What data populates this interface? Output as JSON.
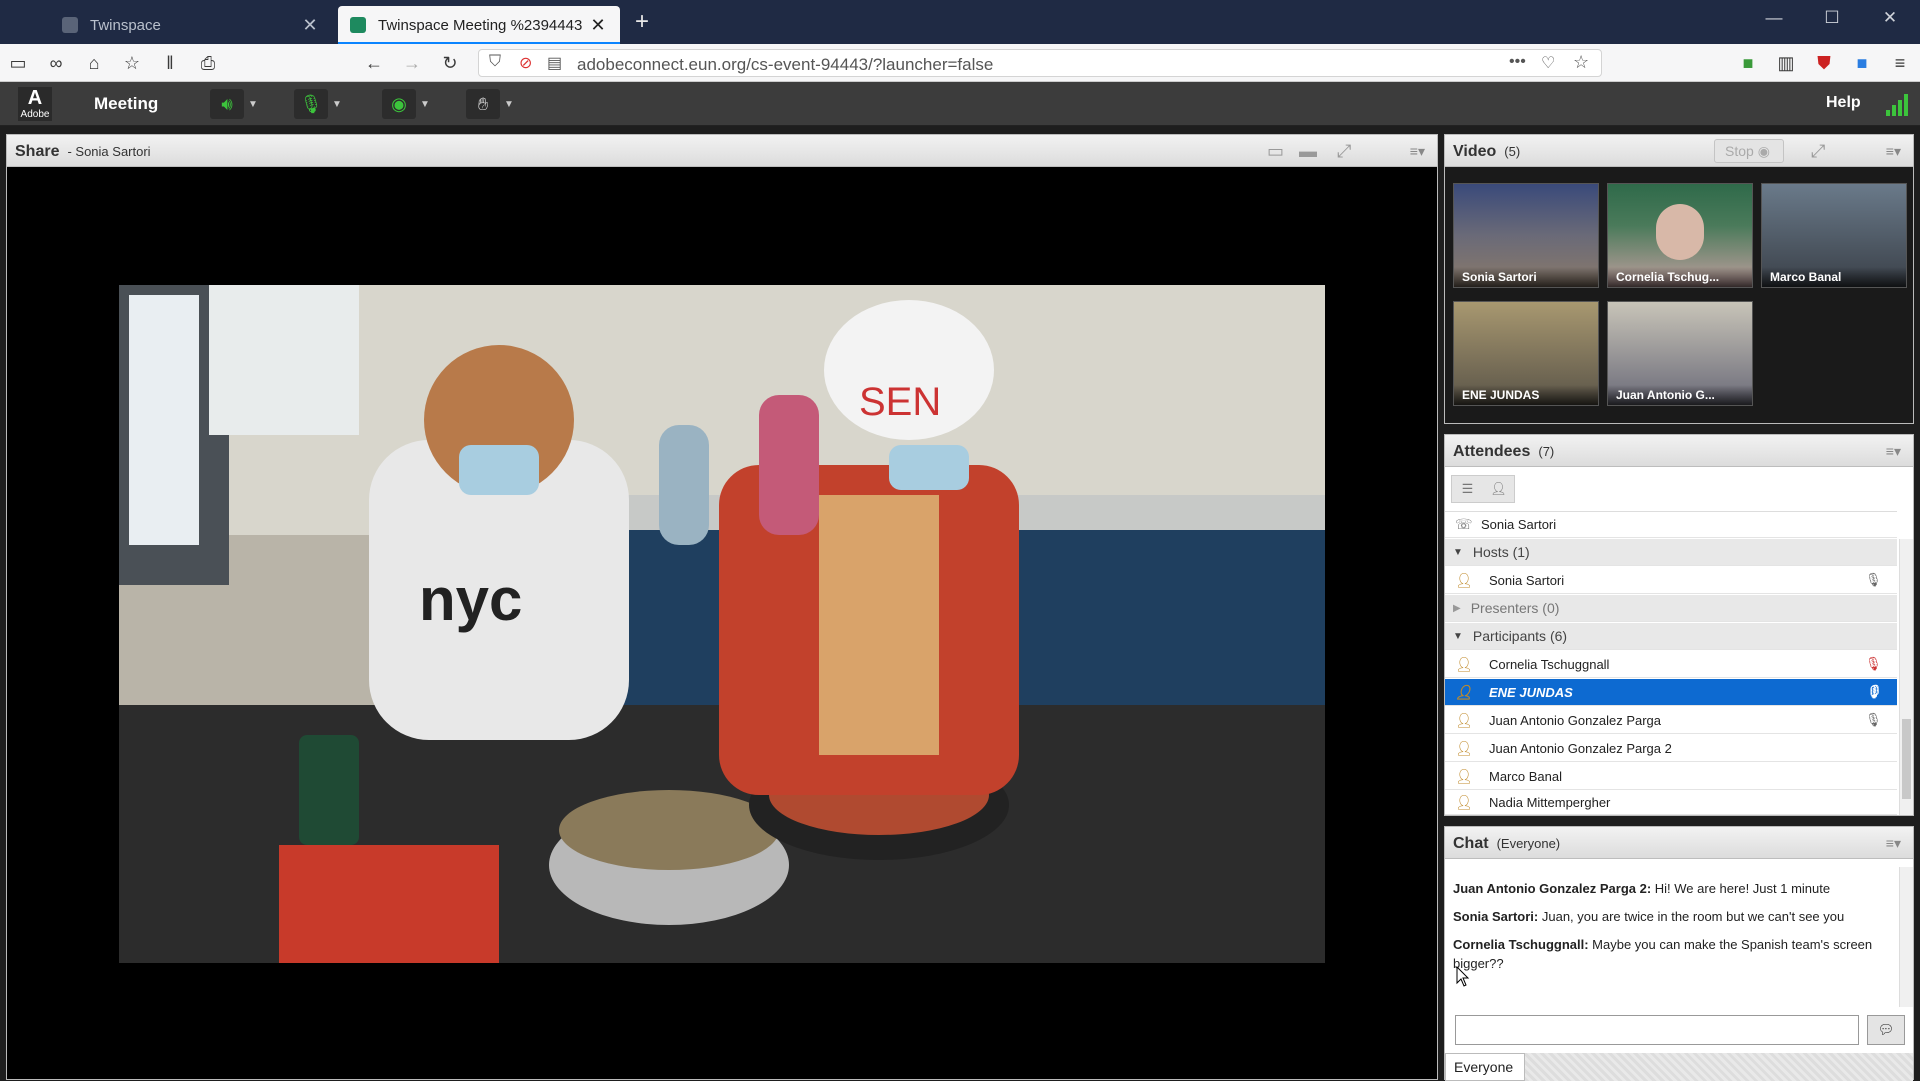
{
  "browser": {
    "tabs": [
      {
        "title": "Twinspace",
        "active": false
      },
      {
        "title": "Twinspace Meeting %2394443",
        "active": true
      }
    ],
    "url": "adobeconnect.eun.org/cs-event-94443/?launcher=false"
  },
  "app": {
    "logo_text": "Adobe",
    "meeting_menu": "Meeting",
    "help": "Help"
  },
  "share": {
    "title": "Share",
    "presenter": "- Sonia Sartori"
  },
  "video": {
    "title": "Video",
    "count": "(5)",
    "stop_label": "Stop",
    "tiles": [
      {
        "name": "Sonia Sartori"
      },
      {
        "name": "Cornelia Tschug..."
      },
      {
        "name": "Marco Banal"
      },
      {
        "name": "ENE JUNDAS"
      },
      {
        "name": "Juan Antonio G..."
      }
    ]
  },
  "attendees": {
    "title": "Attendees",
    "count": "(7)",
    "me": "Sonia Sartori",
    "hosts_label": "Hosts (1)",
    "hosts": [
      "Sonia Sartori"
    ],
    "presenters_label": "Presenters (0)",
    "participants_label": "Participants (6)",
    "participants": [
      "Cornelia Tschuggnall",
      "ENE JUNDAS",
      "Juan Antonio Gonzalez Parga",
      "Juan Antonio Gonzalez Parga 2",
      "Marco Banal",
      "Nadia Mittempergher"
    ]
  },
  "chat": {
    "title": "Chat",
    "audience": "(Everyone)",
    "messages": [
      {
        "sender": "Juan Antonio Gonzalez Parga 2:",
        "text": " Hi! We are here! Just 1 minute"
      },
      {
        "sender": "Sonia Sartori:",
        "text": " Juan, you are twice in the room but we can't see you"
      },
      {
        "sender": "Cornelia Tschuggnall:",
        "text": " Maybe you can make the Spanish team's screen bigger??"
      }
    ],
    "tab_label": "Everyone"
  },
  "colors": {
    "selection": "#0d6ad1",
    "firefox_accent": "#0a84ff",
    "audio_green": "#3cc43c"
  }
}
